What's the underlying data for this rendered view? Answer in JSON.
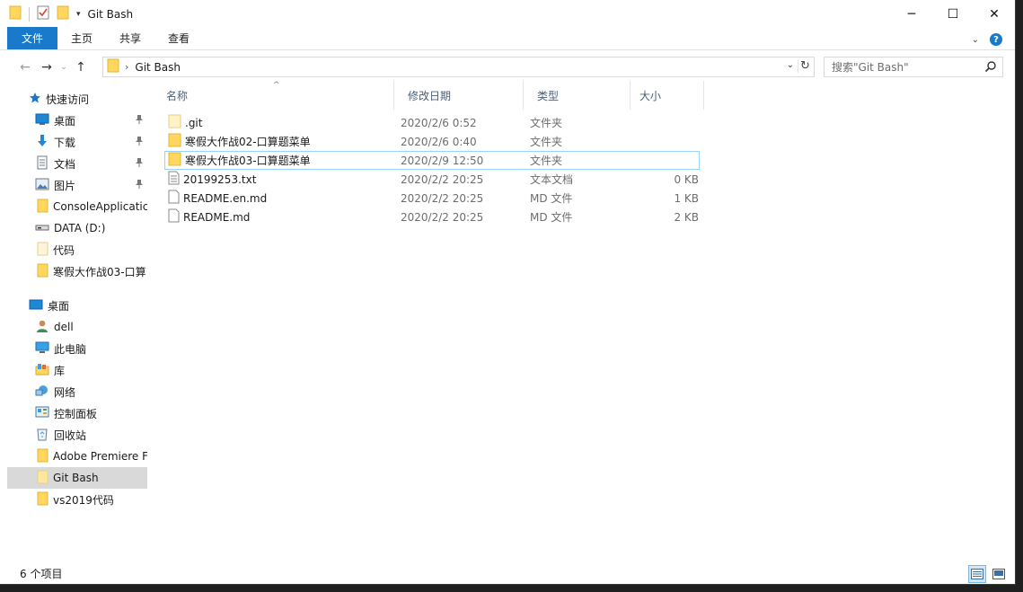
{
  "window": {
    "title": "Git Bash",
    "controls": {
      "minimize": "─",
      "maximize": "☐",
      "close": "✕"
    }
  },
  "ribbon": {
    "tabs": [
      "文件",
      "主页",
      "共享",
      "查看"
    ]
  },
  "nav": {
    "back": "←",
    "forward": "→",
    "recent": "⌄",
    "up": "↑"
  },
  "address": {
    "path": "Git Bash",
    "separator": "›"
  },
  "search": {
    "placeholder": "搜索\"Git Bash\""
  },
  "sidebar": {
    "quick_access": {
      "label": "快速访问",
      "icon": "star-icon"
    },
    "pinned": [
      {
        "label": "桌面",
        "icon": "desktop-icon",
        "pinned": true
      },
      {
        "label": "下载",
        "icon": "download-icon",
        "pinned": true
      },
      {
        "label": "文档",
        "icon": "documents-icon",
        "pinned": true
      },
      {
        "label": "图片",
        "icon": "pictures-icon",
        "pinned": true
      },
      {
        "label": "ConsoleApplicatic",
        "icon": "folder-icon",
        "pinned": false
      },
      {
        "label": "DATA (D:)",
        "icon": "drive-icon",
        "pinned": false
      },
      {
        "label": "代码",
        "icon": "folder-icon",
        "pinned": false
      },
      {
        "label": "寒假大作战03-口算",
        "icon": "folder-icon",
        "pinned": false
      }
    ],
    "desktop": {
      "label": "桌面",
      "icon": "desktop-icon"
    },
    "tree": [
      {
        "label": "dell",
        "icon": "user-icon"
      },
      {
        "label": "此电脑",
        "icon": "computer-icon"
      },
      {
        "label": "库",
        "icon": "library-icon"
      },
      {
        "label": "网络",
        "icon": "network-icon"
      },
      {
        "label": "控制面板",
        "icon": "control-panel-icon"
      },
      {
        "label": "回收站",
        "icon": "recycle-bin-icon"
      },
      {
        "label": "Adobe Premiere F",
        "icon": "folder-icon"
      },
      {
        "label": "Git Bash",
        "icon": "folder-icon",
        "selected": true
      },
      {
        "label": "vs2019代码",
        "icon": "folder-icon"
      }
    ]
  },
  "columns": [
    "名称",
    "修改日期",
    "类型",
    "大小"
  ],
  "files": [
    {
      "name": ".git",
      "date": "2020/2/6 0:52",
      "type": "文件夹",
      "size": "",
      "icon": "folder-icon"
    },
    {
      "name": "寒假大作战02-口算题菜单",
      "date": "2020/2/6 0:40",
      "type": "文件夹",
      "size": "",
      "icon": "folder-icon"
    },
    {
      "name": "寒假大作战03-口算题菜单",
      "date": "2020/2/9 12:50",
      "type": "文件夹",
      "size": "",
      "icon": "folder-icon",
      "selected": true
    },
    {
      "name": "20199253.txt",
      "date": "2020/2/2 20:25",
      "type": "文本文档",
      "size": "0 KB",
      "icon": "text-file-icon"
    },
    {
      "name": "README.en.md",
      "date": "2020/2/2 20:25",
      "type": "MD 文件",
      "size": "1 KB",
      "icon": "file-icon"
    },
    {
      "name": "README.md",
      "date": "2020/2/2 20:25",
      "type": "MD 文件",
      "size": "2 KB",
      "icon": "file-icon"
    }
  ],
  "status": {
    "item_count": "6 个项目"
  },
  "colors": {
    "accent": "#1979ca",
    "folder": "#ffd75e",
    "selection_border": "#99d1ff",
    "selected_nav": "#d9d9d9"
  }
}
